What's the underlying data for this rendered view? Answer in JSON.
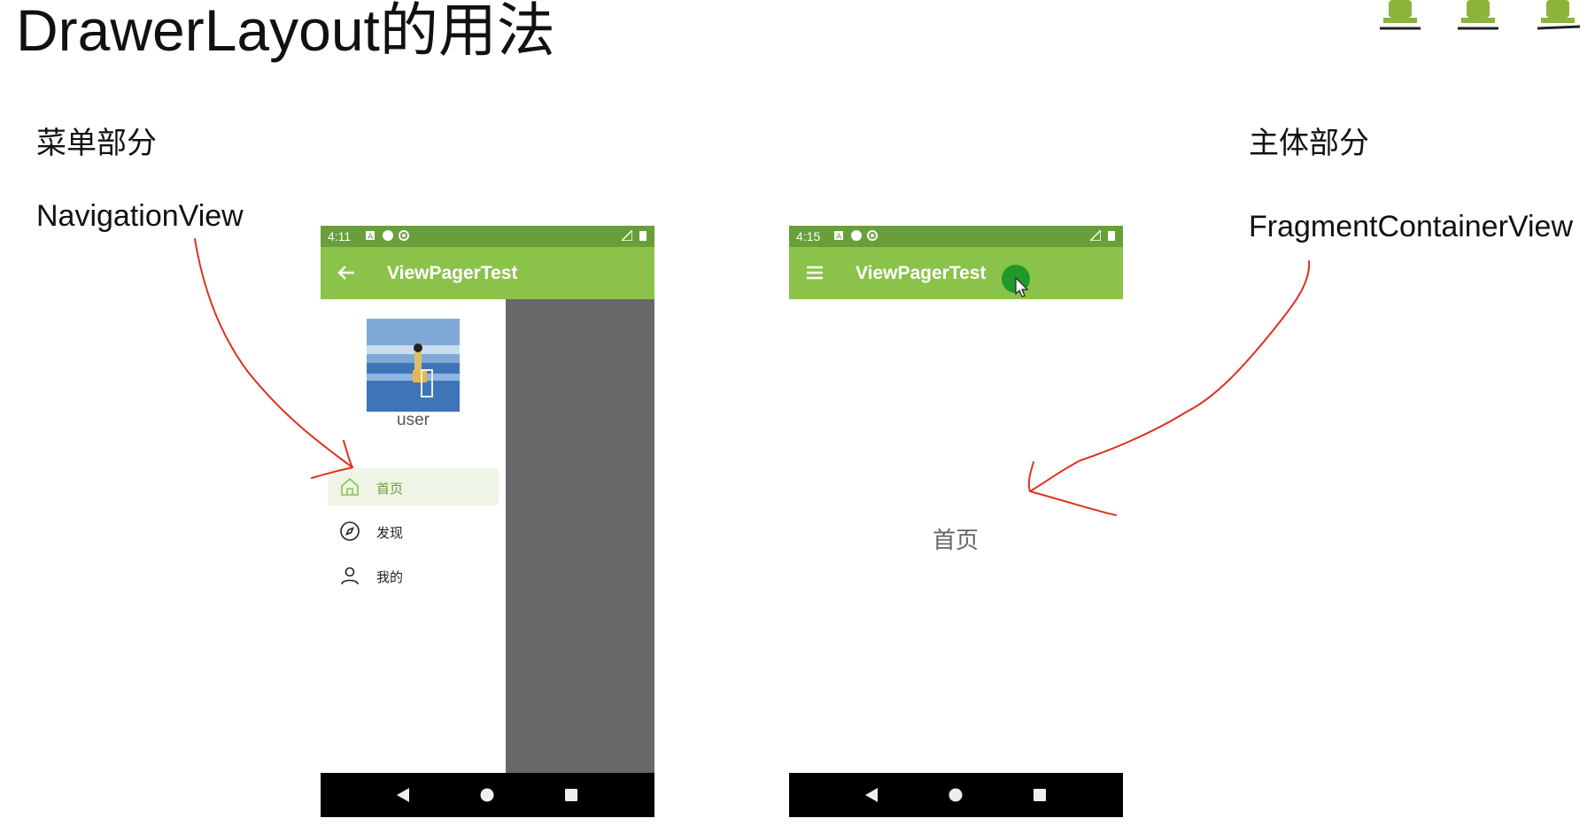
{
  "slide": {
    "title": "DrawerLayout的用法",
    "left_heading": "菜单部分",
    "left_subheading": "NavigationView",
    "right_heading": "主体部分",
    "right_subheading": "FragmentContainerView"
  },
  "phone_left": {
    "status_time": "4:11",
    "appbar_title": "ViewPagerTest",
    "nav_icon": "back-arrow-icon",
    "drawer": {
      "user_name": "user",
      "menu": [
        {
          "label": "首页",
          "icon": "home-icon",
          "active": true
        },
        {
          "label": "发现",
          "icon": "compass-icon",
          "active": false
        },
        {
          "label": "我的",
          "icon": "person-icon",
          "active": false
        }
      ]
    }
  },
  "phone_right": {
    "status_time": "4:15",
    "appbar_title": "ViewPagerTest",
    "nav_icon": "hamburger-menu-icon",
    "content_text": "首页"
  },
  "colors": {
    "status_bar": "#689f38",
    "app_bar": "#8bc34a",
    "accent": "#689f38",
    "scrim": "#686868",
    "annotation_red": "#e0301e",
    "cursor_dot": "#1f9a2a"
  }
}
